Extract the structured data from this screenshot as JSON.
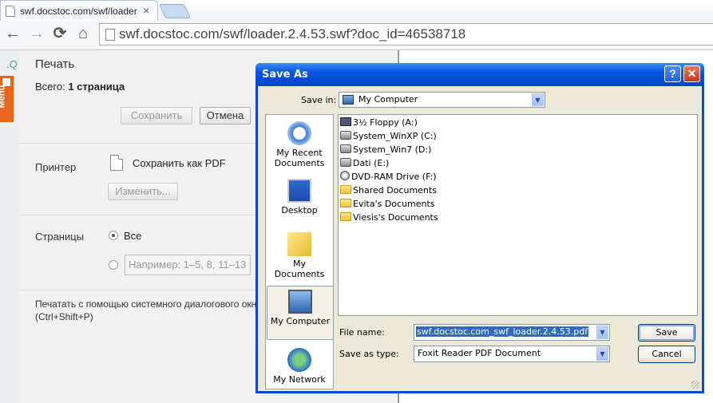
{
  "browser": {
    "tab_title": "swf.docstoc.com/swf/loader",
    "tab_close": "×",
    "url": "swf.docstoc.com/swf/loader.2.4.53.swf?doc_id=46538718",
    "back_icon": "←",
    "forward_icon": "→",
    "reload_icon": "⟳",
    "home_icon": "⌂"
  },
  "menu_tab": {
    "label": "Menu"
  },
  "print_panel": {
    "title": "Печать",
    "total_label": "Всего:",
    "total_value": "1 страница",
    "save_button": "Сохранить",
    "cancel_button": "Отмена",
    "printer_label": "Принтер",
    "printer_name": "Сохранить как PDF",
    "change_button": "Изменить...",
    "pages_label": "Страницы",
    "pages_all": "Все",
    "pages_placeholder": "Например: 1–5, 8, 11–13",
    "system_dialog_note": "Печатать с помощью системного диалогового окна (Ctrl+Shift+P)"
  },
  "save_dialog": {
    "title": "Save As",
    "help_button": "?",
    "close_button": "✕",
    "save_in_label": "Save in:",
    "save_in_value": "My Computer",
    "places": [
      {
        "label": "My Recent Documents"
      },
      {
        "label": "Desktop"
      },
      {
        "label": "My Documents"
      },
      {
        "label": "My Computer"
      },
      {
        "label": "My Network"
      }
    ],
    "files": [
      {
        "name": "3½ Floppy (A:)",
        "icon": "floppy"
      },
      {
        "name": "System_WinXP (C:)",
        "icon": "drive"
      },
      {
        "name": "System_Win7 (D:)",
        "icon": "drive"
      },
      {
        "name": "Dati (E:)",
        "icon": "drive"
      },
      {
        "name": "DVD-RAM Drive (F:)",
        "icon": "dvd"
      },
      {
        "name": "Shared Documents",
        "icon": "folder"
      },
      {
        "name": "Evita's Documents",
        "icon": "folder"
      },
      {
        "name": "Viesis's Documents",
        "icon": "folder"
      }
    ],
    "file_name_label": "File name:",
    "file_name_value": "swf.docstoc.com_swf_loader.2.4.53.pdf",
    "save_as_type_label": "Save as type:",
    "save_as_type_value": "Foxit Reader PDF Document",
    "save_button": "Save",
    "cancel_button": "Cancel"
  },
  "colors": {
    "dialog_title_bar": "#0a55e0",
    "dialog_body": "#ece9d8",
    "selection": "#316ac5",
    "menu_tab": "#e8641d"
  }
}
